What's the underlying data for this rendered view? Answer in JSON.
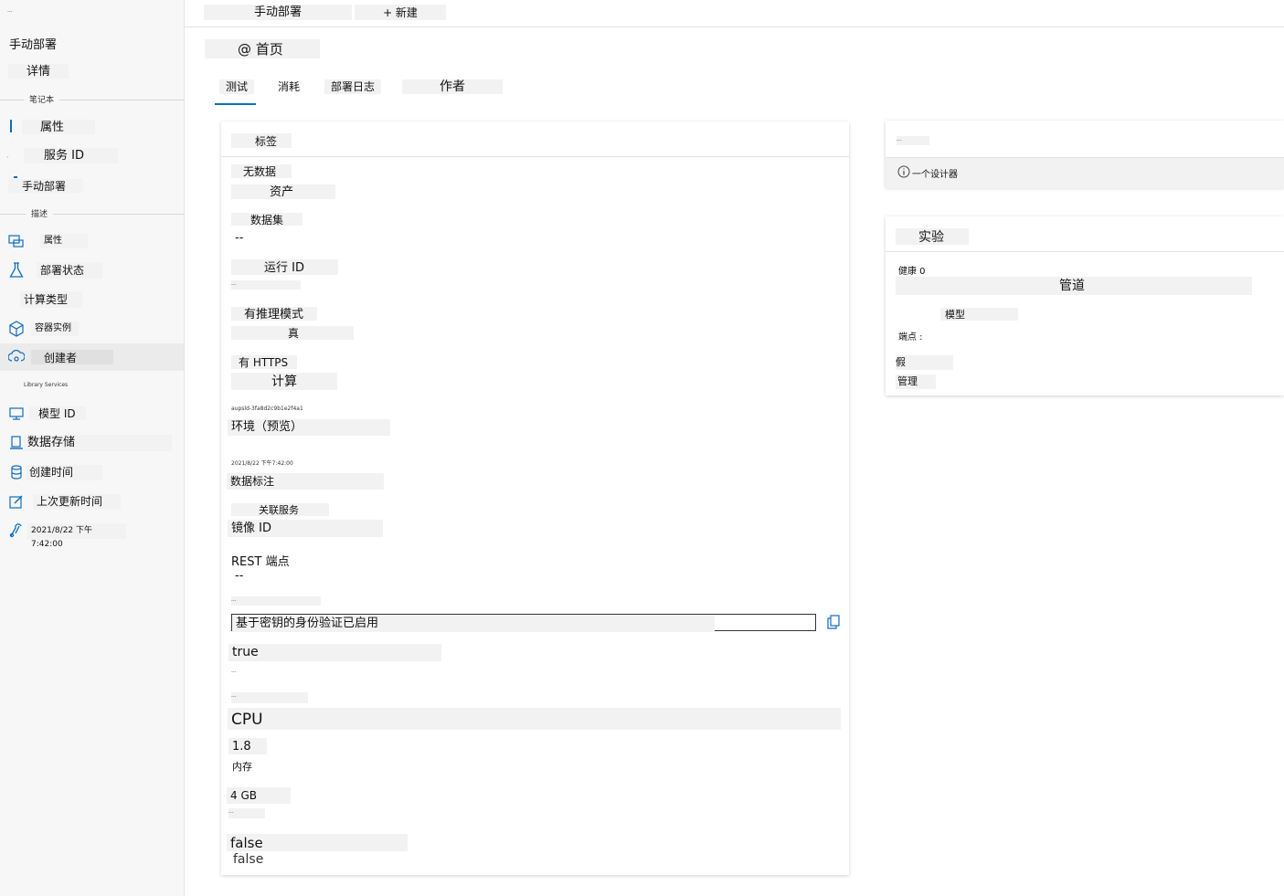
{
  "sidebar": {
    "tiny_header": "...",
    "title": "手动部署",
    "details": "详情",
    "section_notebook": "笔记本",
    "properties": "属性",
    "service_id": "服务 ID",
    "manual_deploy": "手动部署",
    "section_description": "描述",
    "items": [
      {
        "label": "属性",
        "icon": "data-icon"
      },
      {
        "label": "部署状态",
        "icon": "flask-icon"
      },
      {
        "label": "计算类型",
        "icon": ""
      },
      {
        "label": "容器实例",
        "icon": "cube-icon"
      },
      {
        "label": "创建者",
        "icon": "cloud-eye-icon"
      },
      {
        "label": "模型 ID",
        "icon": "monitor-icon"
      },
      {
        "label": "数据存储",
        "icon": "labeling-icon"
      },
      {
        "label": "创建时间",
        "icon": "database-icon"
      },
      {
        "label": "上次更新时间",
        "icon": "edit-icon"
      },
      {
        "label": "2021/8/22 下午7:42:00",
        "icon": "linked-service-icon"
      }
    ],
    "tiny_section_3": "Library Services"
  },
  "topbar": {
    "manual_deploy": "手动部署",
    "new": "+ 新建"
  },
  "breadcrumb": "@ 首页",
  "tabs": [
    "测试",
    "消耗",
    "部署日志",
    "作者"
  ],
  "details_card": {
    "header": "标签",
    "no_data": "无数据",
    "assets": "资产",
    "dataset": "数据集",
    "dataset_value": "--",
    "run_id": "运行 ID",
    "run_id_value": "...",
    "has_inference_schema": "有推理模式",
    "has_inference_schema_value": "真",
    "has_https": "有 HTTPS",
    "compute": "计算",
    "compute_value": "aupsld-3fa8d2c9b1e2f4a1",
    "environment": "环境（预览）",
    "created_on_value": "2021/8/22 下午7:42:00",
    "data_labeling": "数据标注",
    "linked_services": "关联服务",
    "image_id": "镜像 ID",
    "rest_endpoint": "REST 端点",
    "rest_endpoint_value": "--",
    "tiny_label_1": "...",
    "key_auth": "基于密钥的身份验证已启用",
    "true_value": "true",
    "tiny_label_2": "...",
    "tiny_label_3": "...",
    "cpu": "CPU",
    "cpu_value": "1.8",
    "memory": "内存",
    "memory_value": "4 GB",
    "tiny_label_4": "...",
    "false_value_1": "false",
    "false_value_2": "false"
  },
  "info_card": {
    "tiny_title": "...",
    "designer_note": "一个设计器"
  },
  "experiment_card": {
    "header": "实验",
    "health": "健康 0",
    "pipeline": "管道",
    "model": "模型",
    "endpoint": "端点 :",
    "fake": "假",
    "manage": "管理"
  }
}
